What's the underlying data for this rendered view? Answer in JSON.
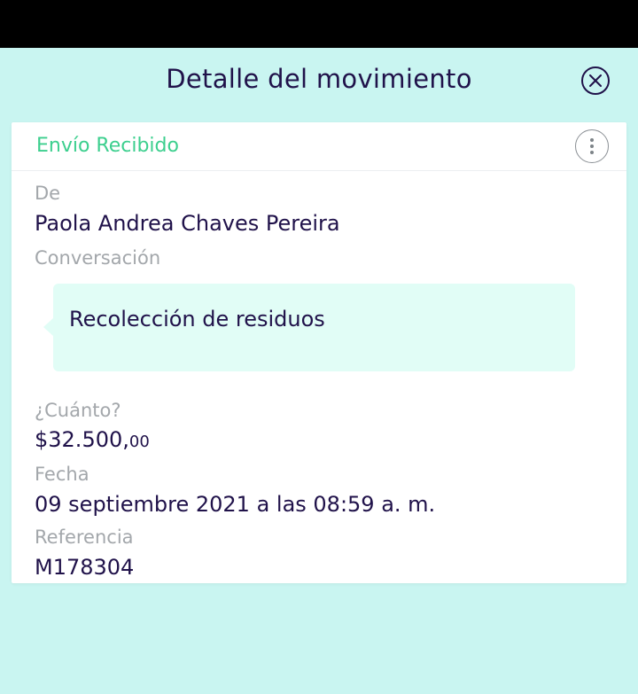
{
  "header": {
    "title": "Detalle del movimiento",
    "close_icon": "close-icon"
  },
  "card": {
    "status": "Envío Recibido",
    "menu_icon": "more-vertical-icon",
    "from_label": "De",
    "from_value": "Paola Andrea Chaves Pereira",
    "conversation_label": "Conversación",
    "message": "Recolección de residuos",
    "amount_label": "¿Cuánto?",
    "amount_main": "$32.500,",
    "amount_cents": "00",
    "date_label": "Fecha",
    "date_value": "09 septiembre 2021 a las 08:59 a. m.",
    "reference_label": "Referencia",
    "reference_value": "M178304"
  },
  "colors": {
    "background": "#c9f5f1",
    "text_dark": "#20124a",
    "status_green": "#3ccf8e",
    "label_gray": "#a3a7ab",
    "bubble": "#e1fdf6"
  }
}
